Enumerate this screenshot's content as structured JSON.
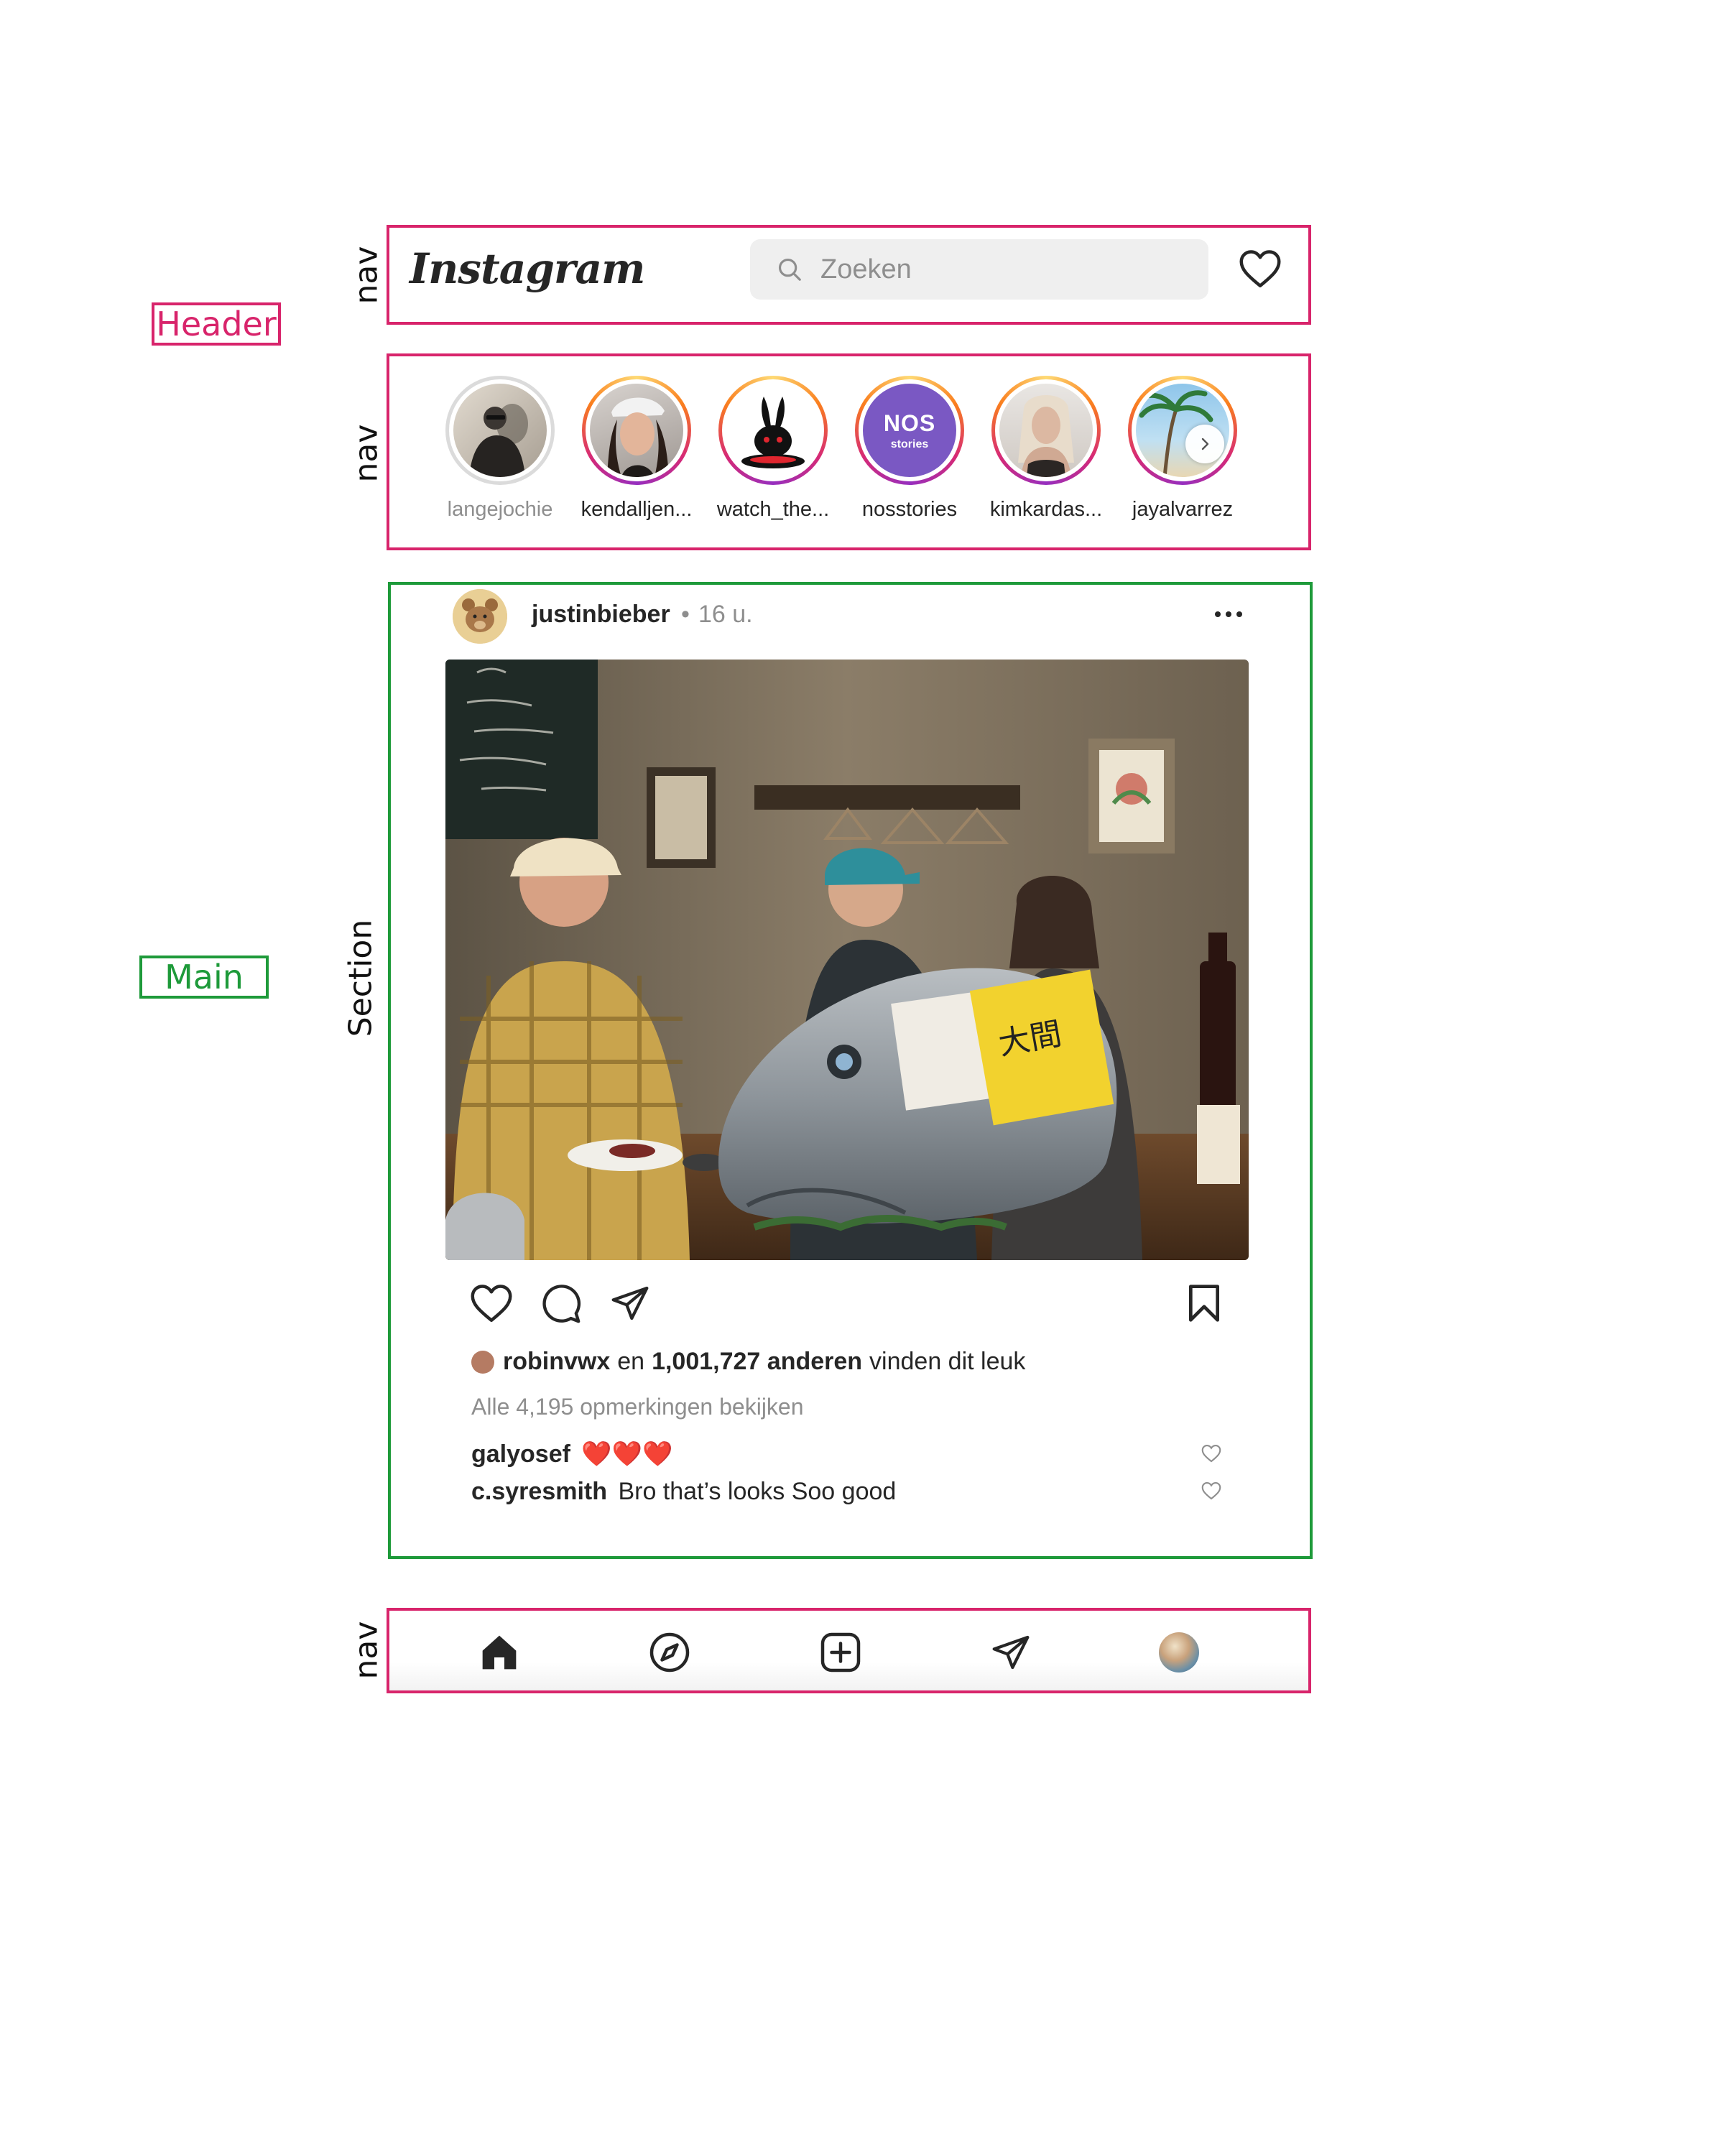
{
  "annotations": {
    "header_nav_label": "nav",
    "stories_nav_label": "nav",
    "section_label": "Section",
    "bottom_nav_label": "nav",
    "header_tag": "Header",
    "main_tag": "Main"
  },
  "colors": {
    "header_outline": "#d8246b",
    "main_outline": "#1e9a3a",
    "story_ring_gradient": [
      "#feda75",
      "#fa7e1e",
      "#d62976",
      "#962fbf"
    ],
    "nos_brand": "#7a58c3"
  },
  "header": {
    "logo": "Instagram",
    "search_placeholder": "Zoeken",
    "icons": [
      "search-icon",
      "heart-icon"
    ]
  },
  "stories": [
    {
      "username": "langejochie",
      "seen": true
    },
    {
      "username": "kendalljen...",
      "seen": false
    },
    {
      "username": "watch_the...",
      "seen": false
    },
    {
      "username": "nosstories",
      "seen": false,
      "logo_top": "NOS",
      "logo_bottom": "stories"
    },
    {
      "username": "kimkardas...",
      "seen": false
    },
    {
      "username": "jayalvarrez",
      "seen": false
    }
  ],
  "post": {
    "username": "justinbieber",
    "separator": "•",
    "time": "16 u.",
    "photo_sign": "大間",
    "action_icons": [
      "heart-icon",
      "comment-icon",
      "share-icon",
      "bookmark-icon"
    ],
    "likes": {
      "liker": "robinvwx",
      "connector": "en",
      "others": "1,001,727 anderen",
      "suffix": "vinden dit leuk"
    },
    "view_comments": "Alle 4,195 opmerkingen bekijken",
    "comments": [
      {
        "user": "galyosef",
        "text": "❤️❤️❤️"
      },
      {
        "user": "c.syresmith",
        "text": "Bro that’s looks Soo good"
      }
    ]
  },
  "bottom_nav": {
    "icons": [
      "home-icon",
      "explore-icon",
      "new-post-icon",
      "direct-icon",
      "profile-avatar"
    ]
  }
}
